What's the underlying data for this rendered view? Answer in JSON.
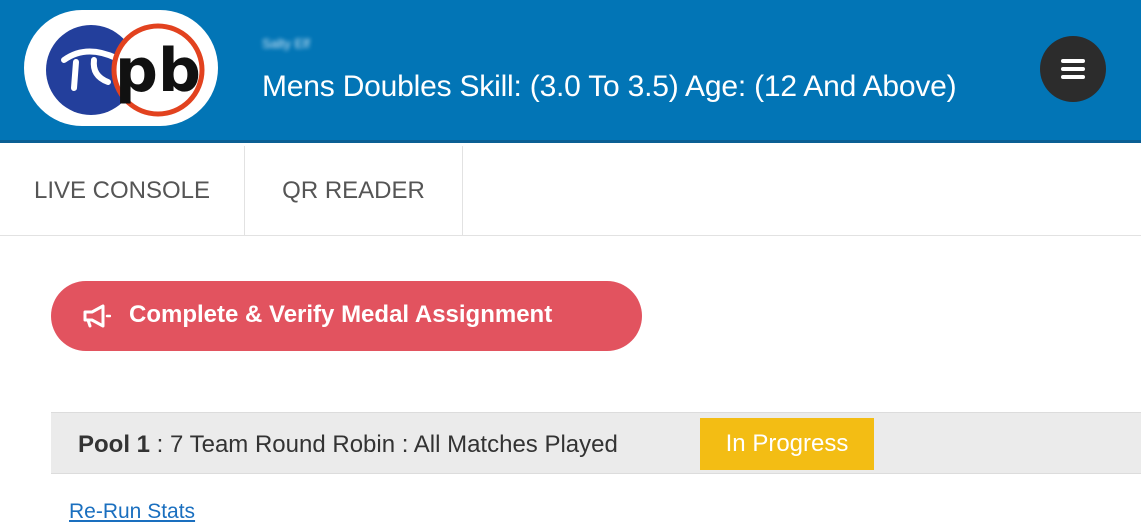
{
  "header": {
    "organizer": "Salty Elf",
    "event_title": "Mens Doubles Skill: (3.0 To 3.5) Age: (12 And Above)",
    "logo_text": "pb",
    "logo_icon": "pickleball-logo",
    "menu_icon": "hamburger-icon",
    "colors": {
      "bar": "#0275b6",
      "logo_ring": "#e2421f",
      "logo_blue": "#233f9c"
    }
  },
  "tabs": [
    {
      "label": "LIVE CONSOLE"
    },
    {
      "label": "QR READER"
    }
  ],
  "actions": {
    "verify_label": "Complete & Verify Medal Assignment",
    "verify_icon": "megaphone-icon",
    "verify_color": "#e2535f"
  },
  "pool": {
    "name": "Pool 1",
    "separator": " : ",
    "description": "7 Team Round Robin : All Matches Played",
    "status": "In Progress",
    "status_color": "#f3bd14"
  },
  "links": {
    "rerun": "Re-Run Stats"
  }
}
